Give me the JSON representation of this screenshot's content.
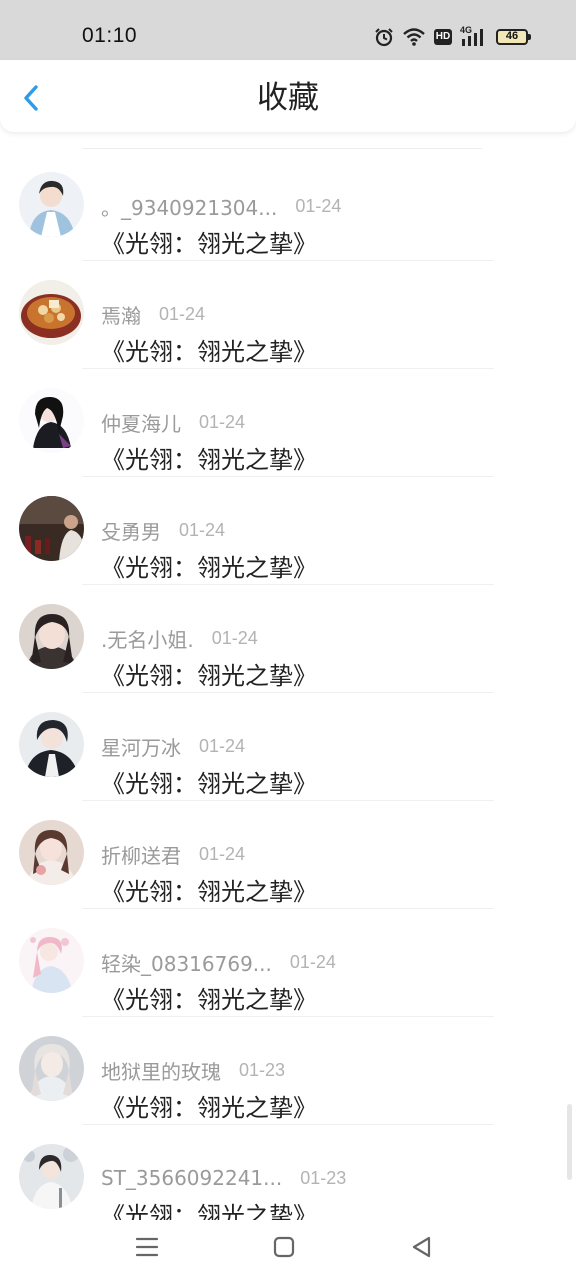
{
  "status_bar": {
    "time": "01:10",
    "icons": [
      "alarm-icon",
      "wifi-icon",
      "hd-icon",
      "signal-4g-icon",
      "battery-icon"
    ],
    "hd_label": "HD",
    "network_label": "4G",
    "battery_level": "46"
  },
  "header": {
    "back_icon": "chevron-left-icon",
    "title": "收藏",
    "accent_color": "#2f9ae8"
  },
  "items": [
    {
      "name": "。_9340921304...",
      "date": "01-24",
      "title": "《光翎：翎光之挚》",
      "avatar": "avatar-anime-boy"
    },
    {
      "name": "焉瀚",
      "date": "01-24",
      "title": "《光翎：翎光之挚》",
      "avatar": "avatar-food-bowl"
    },
    {
      "name": "仲夏海儿",
      "date": "01-24",
      "title": "《光翎：翎光之挚》",
      "avatar": "avatar-anime-girl-dark"
    },
    {
      "name": "殳勇男",
      "date": "01-24",
      "title": "《光翎：翎光之挚》",
      "avatar": "avatar-photo-dark"
    },
    {
      "name": ".无名小姐.",
      "date": "01-24",
      "title": "《光翎：翎光之挚》",
      "avatar": "avatar-girl-photo"
    },
    {
      "name": "星河万冰",
      "date": "01-24",
      "title": "《光翎：翎光之挚》",
      "avatar": "avatar-anime-boy-dark"
    },
    {
      "name": "折柳送君",
      "date": "01-24",
      "title": "《光翎：翎光之挚》",
      "avatar": "avatar-girl-pink"
    },
    {
      "name": "轻染_08316769...",
      "date": "01-24",
      "title": "《光翎：翎光之挚》",
      "avatar": "avatar-anime-pink"
    },
    {
      "name": "地狱里的玫瑰",
      "date": "01-23",
      "title": "《光翎：翎光之挚》",
      "avatar": "avatar-girl-white"
    },
    {
      "name": "ST_3566092241...",
      "date": "01-23",
      "title": "《光翎：翎光之挚》",
      "avatar": "avatar-snow-girl"
    }
  ],
  "nav_bar": {
    "icons": [
      "menu-icon",
      "home-square-icon",
      "back-triangle-icon"
    ]
  }
}
